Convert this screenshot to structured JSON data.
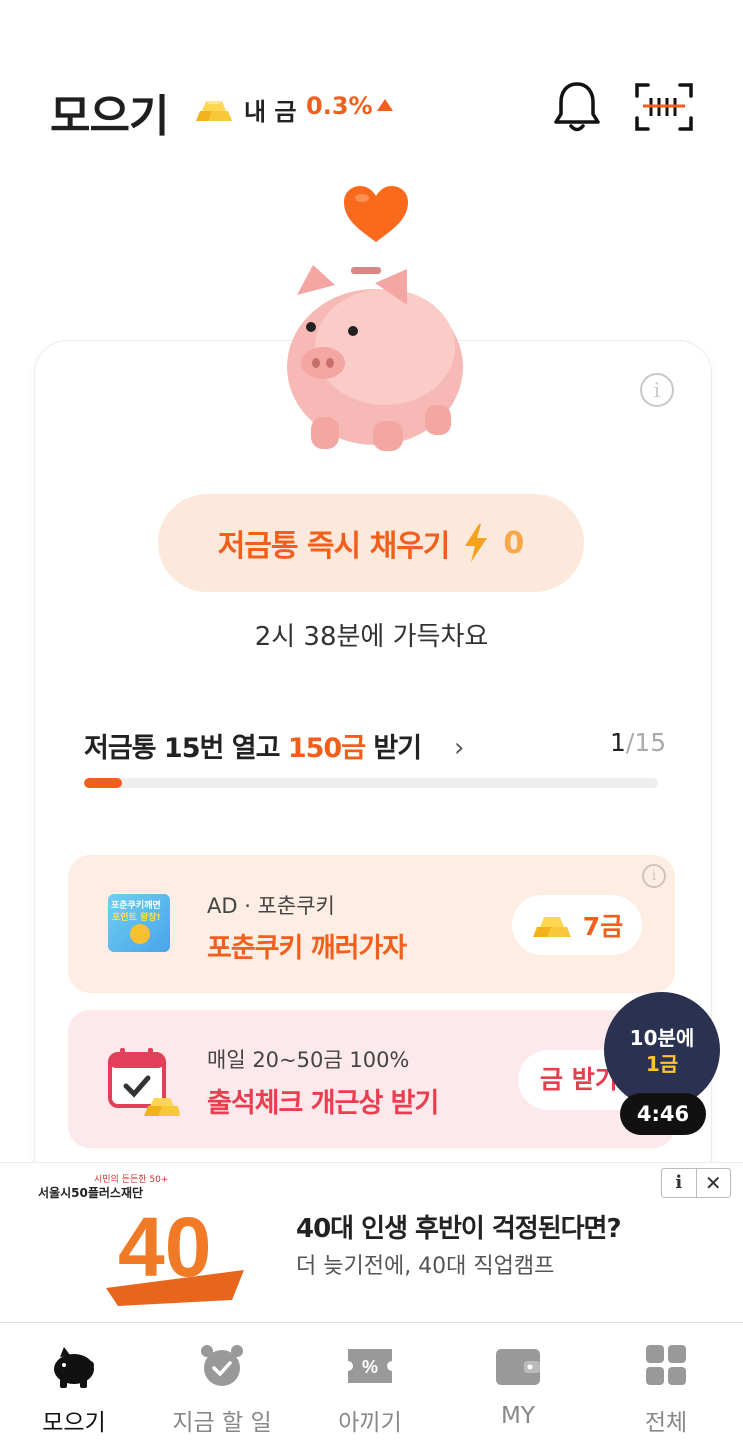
{
  "header": {
    "title": "모으기",
    "my_gold_label": "내 금",
    "my_gold_change": "0.3%"
  },
  "piggy": {
    "fill_button_label": "저금통 즉시 채우기",
    "fill_button_count": "0",
    "full_time_text": "2시 38분에 가득차요"
  },
  "goal": {
    "label_prefix": "저금통 15번 열고 ",
    "label_accent": "150금",
    "label_suffix": " 받기",
    "progress_current": "1",
    "progress_total": "/15",
    "progress_fraction": 0.0667
  },
  "missions": [
    {
      "subtitle": "AD · 포춘쿠키",
      "title": "포춘쿠키 깨러가자",
      "reward": "7금",
      "thumb_line1": "포춘쿠키깨면",
      "thumb_line2": "포인트 왕창!"
    },
    {
      "subtitle": "매일 20~50금 100%",
      "title": "출석체크 개근상 받기",
      "reward": "금 받기"
    }
  ],
  "timer": {
    "line1": "10분에",
    "line2": "1금",
    "countdown": "4:46"
  },
  "banner": {
    "small_text": "시민의 든든한 50+",
    "org": "서울시50플러스재단",
    "logo_text": "40",
    "title": "40대 인생 후반이 걱정된다면?",
    "subtitle": "더 늦기전에, 40대 직업캠프",
    "badge_info": "i",
    "badge_close": "✕"
  },
  "nav": [
    {
      "label": "모으기",
      "icon": "piggy-bank-icon",
      "active": true
    },
    {
      "label": "지금 할 일",
      "icon": "alarm-clock-icon",
      "active": false
    },
    {
      "label": "아끼기",
      "icon": "coupon-icon",
      "active": false
    },
    {
      "label": "MY",
      "icon": "wallet-icon",
      "active": false
    },
    {
      "label": "전체",
      "icon": "grid-icon",
      "active": false
    }
  ],
  "colors": {
    "accent": "#f25f1c",
    "red": "#ea3d4f",
    "timer_bg": "#2b3150"
  }
}
